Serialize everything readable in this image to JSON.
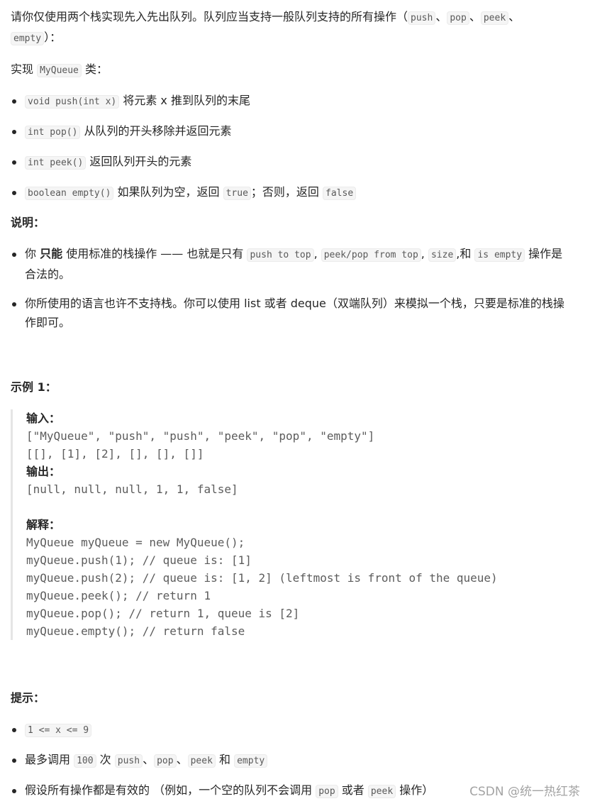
{
  "intro": {
    "text": "请你仅使用两个栈实现先入先出队列。队列应当支持一般队列支持的所有操作（",
    "ops": [
      "push",
      "pop",
      "peek",
      "empty"
    ],
    "sep": "、",
    "tail": "）："
  },
  "impl": {
    "prefix": "实现 ",
    "class_name": "MyQueue",
    "suffix": " 类："
  },
  "methods": [
    {
      "sig": "void push(int x)",
      "desc": "将元素 x 推到队列的末尾"
    },
    {
      "sig": "int pop()",
      "desc": "从队列的开头移除并返回元素"
    },
    {
      "sig": "int peek()",
      "desc": "返回队列开头的元素"
    },
    {
      "sig": "boolean empty()",
      "desc": "如果队列为空，返回",
      "true": "true",
      "mid": "；否则，返回",
      "false": "false"
    }
  ],
  "notes": {
    "heading": "说明：",
    "item1": {
      "a": "你 ",
      "bold": "只能",
      "b": " 使用标准的栈操作 —— 也就是只有 ",
      "c1": "push to top",
      "c2": "peek/pop from top",
      "c3": "size",
      "and": "和 ",
      "c4": "is empty",
      "end": " 操作是合法的。"
    },
    "item2": "你所使用的语言也许不支持栈。你可以使用 list 或者 deque（双端队列）来模拟一个栈，只要是标准的栈操作即可。"
  },
  "example": {
    "heading": "示例 1：",
    "input_label": "输入：",
    "input_lines": [
      "[\"MyQueue\", \"push\", \"push\", \"peek\", \"pop\", \"empty\"]",
      "[[], [1], [2], [], [], []]"
    ],
    "output_label": "输出：",
    "output_lines": [
      "[null, null, null, 1, 1, false]"
    ],
    "explain_label": "解释：",
    "explain_lines": [
      "MyQueue myQueue = new MyQueue();",
      "myQueue.push(1); // queue is: [1]",
      "myQueue.push(2); // queue is: [1, 2] (leftmost is front of the queue)",
      "myQueue.peek(); // return 1",
      "myQueue.pop(); // return 1, queue is [2]",
      "myQueue.empty(); // return false"
    ]
  },
  "tips": {
    "heading": "提示：",
    "t1": "1 <= x <= 9",
    "t2": {
      "a": "最多调用 ",
      "n": "100",
      "b": " 次 ",
      "ops": [
        "push",
        "pop",
        "peek",
        "empty"
      ],
      "sep": "、",
      "and": " 和 "
    },
    "t3": {
      "a": "假设所有操作都是有效的 （例如，一个空的队列不会调用 ",
      "c1": "pop",
      "b": " 或者 ",
      "c2": "peek",
      "end": " 操作）"
    }
  },
  "watermark": "CSDN @统一热红茶"
}
